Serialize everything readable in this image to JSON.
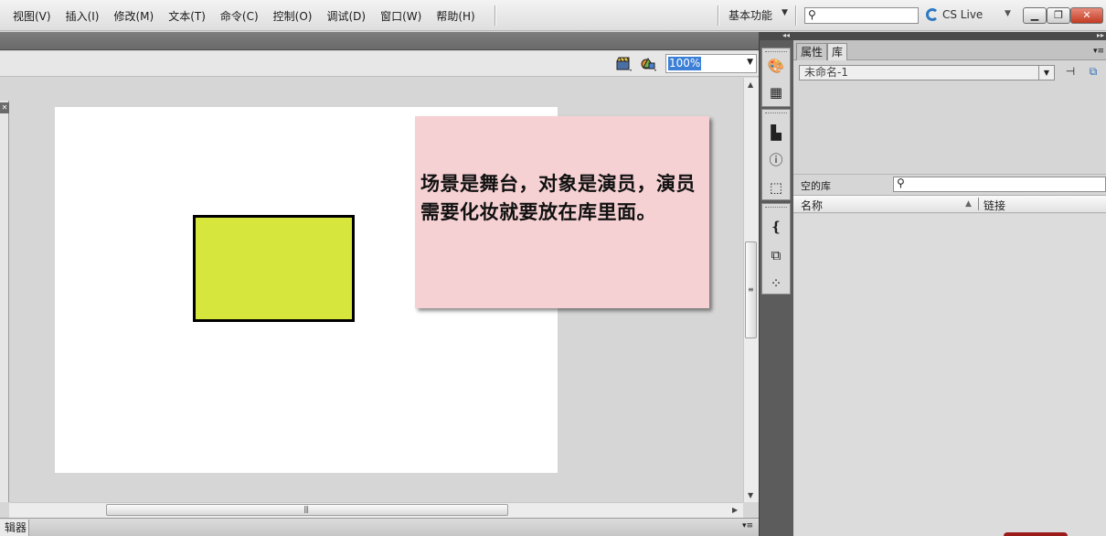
{
  "menu": {
    "items": [
      "视图(V)",
      "插入(I)",
      "修改(M)",
      "文本(T)",
      "命令(C)",
      "控制(O)",
      "调试(D)",
      "窗口(W)",
      "帮助(H)"
    ],
    "workspace_label": "基本功能",
    "cslive_label": "CS Live",
    "search_placeholder": ""
  },
  "editbar": {
    "zoom_value": "100%"
  },
  "stage": {
    "background": "#ffffff",
    "shape_fill": "#d7e63d",
    "note_text": "场景是舞台，对象是演员，演员需要化妆就要放在库里面。",
    "note_background": "#f6d1d3"
  },
  "bottom_panel": {
    "tab_label": "辑器"
  },
  "right_panel": {
    "tabs": [
      {
        "label": "属性",
        "active": false
      },
      {
        "label": "库",
        "active": true
      }
    ],
    "library_selected": "未命名-1",
    "empty_label": "空的库",
    "columns": {
      "name": "名称",
      "link": "链接"
    }
  },
  "dock_icons": [
    "color-palette-icon",
    "swatches-icon",
    "align-icon",
    "info-icon",
    "transform-icon",
    "code-snippets-icon",
    "components-icon",
    "motion-presets-icon"
  ]
}
